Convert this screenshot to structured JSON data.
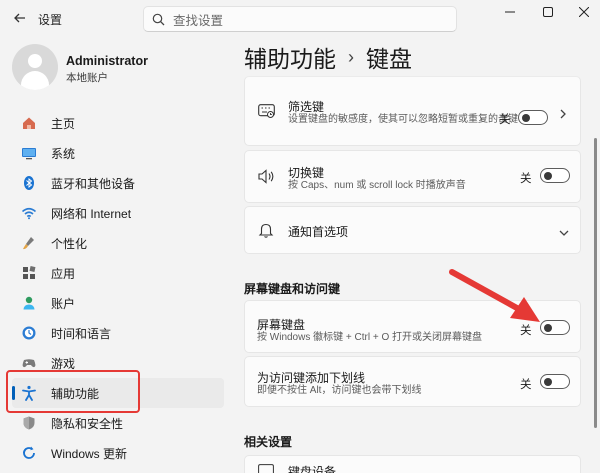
{
  "window": {
    "app_title": "设置",
    "search_placeholder": "查找设置"
  },
  "profile": {
    "name": "Administrator",
    "account_type": "本地账户"
  },
  "sidebar": {
    "items": [
      {
        "label": "主页",
        "icon": "home-icon"
      },
      {
        "label": "系统",
        "icon": "system-icon"
      },
      {
        "label": "蓝牙和其他设备",
        "icon": "bluetooth-icon"
      },
      {
        "label": "网络和 Internet",
        "icon": "wifi-icon"
      },
      {
        "label": "个性化",
        "icon": "brush-icon"
      },
      {
        "label": "应用",
        "icon": "apps-icon"
      },
      {
        "label": "账户",
        "icon": "account-icon"
      },
      {
        "label": "时间和语言",
        "icon": "globe-icon"
      },
      {
        "label": "游戏",
        "icon": "gamepad-icon"
      },
      {
        "label": "辅助功能",
        "icon": "accessibility-icon",
        "active": true
      },
      {
        "label": "隐私和安全性",
        "icon": "shield-icon"
      },
      {
        "label": "Windows 更新",
        "icon": "update-icon"
      }
    ]
  },
  "breadcrumb": {
    "parent": "辅助功能",
    "separator": "›",
    "current": "键盘"
  },
  "cards": {
    "filter_keys": {
      "title": "筛选键",
      "desc": "设置键盘的敏感度，使其可以忽略短暂或重复的击键",
      "state": "关"
    },
    "toggle_keys": {
      "title": "切换键",
      "desc": "按 Caps、num 或 scroll lock 时播放声音",
      "state": "关"
    },
    "notifications": {
      "title": "通知首选项"
    },
    "onscreen_kb": {
      "title": "屏幕键盘",
      "desc": "按 Windows 徽标键 + Ctrl + O 打开或关闭屏幕键盘",
      "state": "关"
    },
    "underline_keys": {
      "title": "为访问键添加下划线",
      "desc": "即便不按住 Alt，访问键也会带下划线",
      "state": "关"
    },
    "keyboard_device": {
      "title": "键盘设备"
    }
  },
  "sections": {
    "onscreen": "屏幕键盘和访问键",
    "related": "相关设置"
  },
  "colors": {
    "accent": "#005fb8",
    "annotation": "#e53935"
  }
}
